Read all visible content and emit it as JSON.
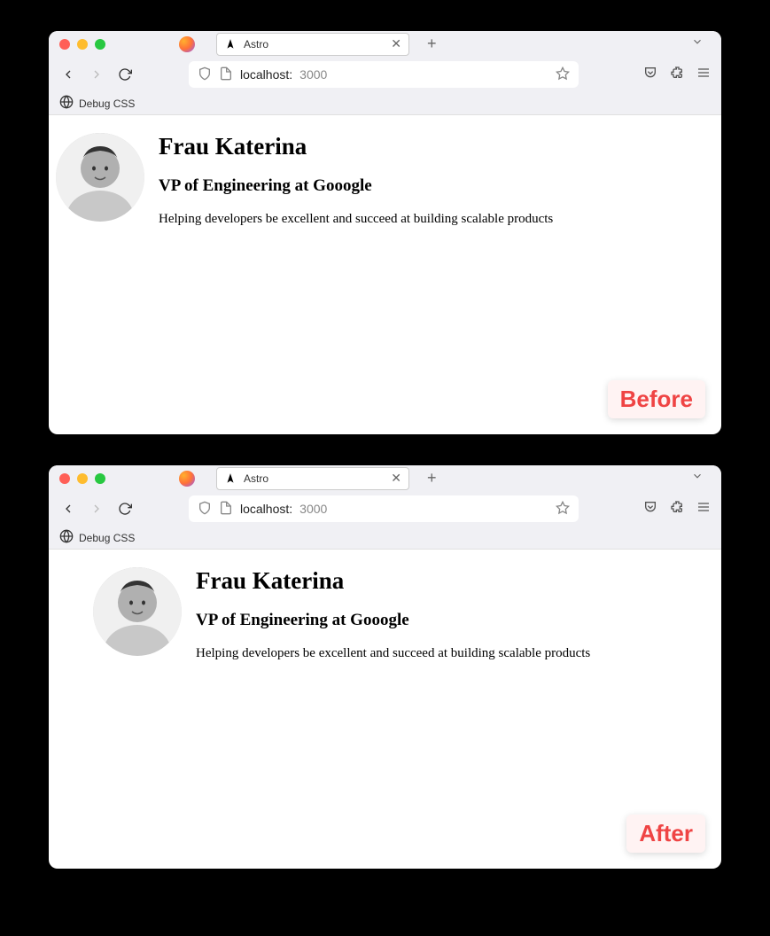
{
  "windows": [
    {
      "tab_title": "Astro",
      "url_host": "localhost:",
      "url_port": "3000",
      "bookmark": "Debug CSS",
      "profile": {
        "name": "Frau Katerina",
        "title": "VP of Engineering at Gooogle",
        "bio": "Helping developers be excellent and succeed at building scalable products"
      },
      "badge": "Before"
    },
    {
      "tab_title": "Astro",
      "url_host": "localhost:",
      "url_port": "3000",
      "bookmark": "Debug CSS",
      "profile": {
        "name": "Frau Katerina",
        "title": "VP of Engineering at Gooogle",
        "bio": "Helping developers be excellent and succeed at building scalable products"
      },
      "badge": "After"
    }
  ]
}
